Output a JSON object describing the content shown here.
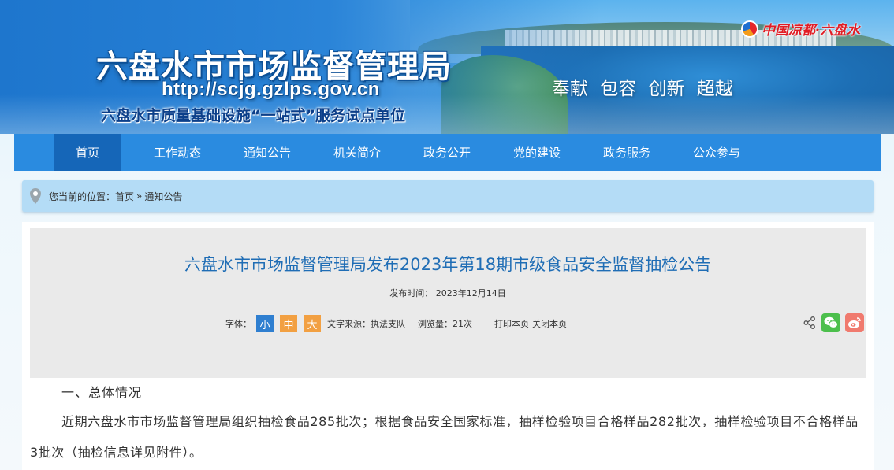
{
  "header": {
    "site_title": "六盘水市市场监督管理局",
    "site_url": "http://scjg.gzlps.gov.cn",
    "subtitle": "六盘水市质量基础设施“一站式”服务试点单位",
    "slogan": "奉献  包容  创新  超越",
    "brand": "中国凉都·六盘水"
  },
  "nav": {
    "items": [
      {
        "label": "首页",
        "active": true
      },
      {
        "label": "工作动态"
      },
      {
        "label": "通知公告"
      },
      {
        "label": "机关简介"
      },
      {
        "label": "政务公开"
      },
      {
        "label": "党的建设"
      },
      {
        "label": "政务服务"
      },
      {
        "label": "公众参与"
      }
    ]
  },
  "breadcrumb": {
    "prefix": "您当前的位置：",
    "home": "首页",
    "separator": "»",
    "current": "通知公告"
  },
  "article": {
    "title": "六盘水市市场监督管理局发布2023年第18期市级食品安全监督抽检公告",
    "publish_label": "发布时间：",
    "publish_date": "2023年12月14日",
    "font_label": "字体：",
    "font_small": "小",
    "font_medium": "中",
    "font_large": "大",
    "source_label": "文字来源：",
    "source": "执法支队",
    "views_label": "浏览量：",
    "views": "21次",
    "print": "打印本页",
    "close": "关闭本页",
    "section1_heading": "一、总体情况",
    "paragraph1": "近期六盘水市市场监督管理局组织抽检食品285批次；根据食品安全国家标准，抽样检验项目合格样品282批次，抽样检验项目不合格样品3批次（抽检信息详见附件）。"
  },
  "colors": {
    "nav_bg": "#2a8be0",
    "nav_active": "#1566b8",
    "title_blue": "#1f6db5",
    "breadcrumb_bg": "#b4dcf6",
    "font_small_btn": "#2f7fd0",
    "font_other_btn": "#f2a042",
    "wechat": "#4cbf4c",
    "weibo": "#f07a6e"
  },
  "icons": {
    "breadcrumb": "location-pin-icon",
    "share": "share-icon",
    "wechat": "wechat-icon",
    "weibo": "weibo-icon"
  }
}
